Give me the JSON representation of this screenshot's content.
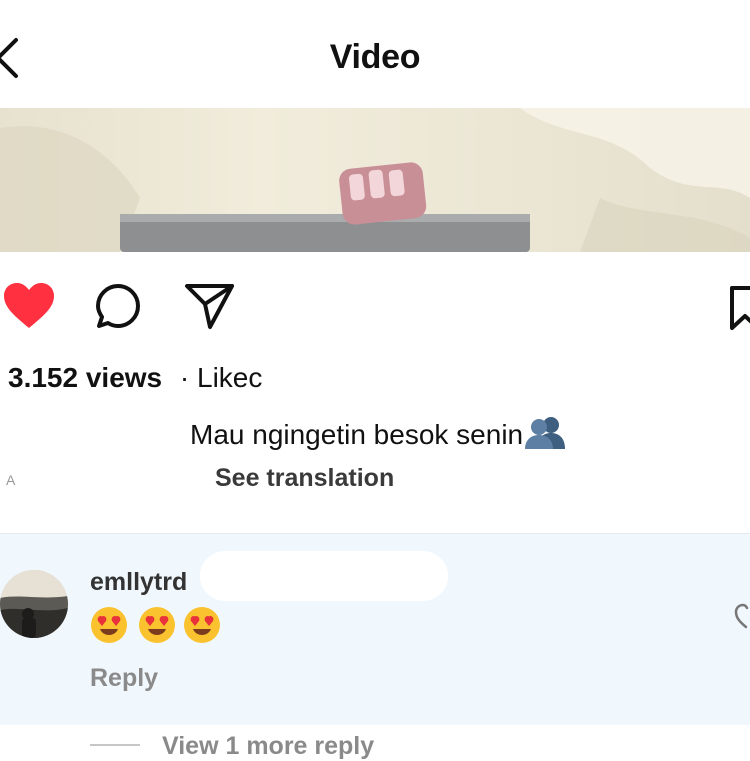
{
  "header": {
    "title": "Video"
  },
  "post": {
    "views": "3.152 views",
    "liked_by": "· Likec",
    "caption": "Mau ngingetin besok senin",
    "see_translation": "See translation",
    "meta_fragment": "A"
  },
  "comment": {
    "username": "emllytrd",
    "emoji_names": [
      "heart-eyes-emoji",
      "heart-eyes-emoji",
      "heart-eyes-emoji"
    ],
    "reply_label": "Reply",
    "more_replies_label": "View 1 more reply"
  },
  "colors": {
    "like_red": "#ff3040",
    "icon_black": "#111111",
    "comment_bg": "#f1f8fd",
    "muted_text": "#8a8a8a"
  }
}
